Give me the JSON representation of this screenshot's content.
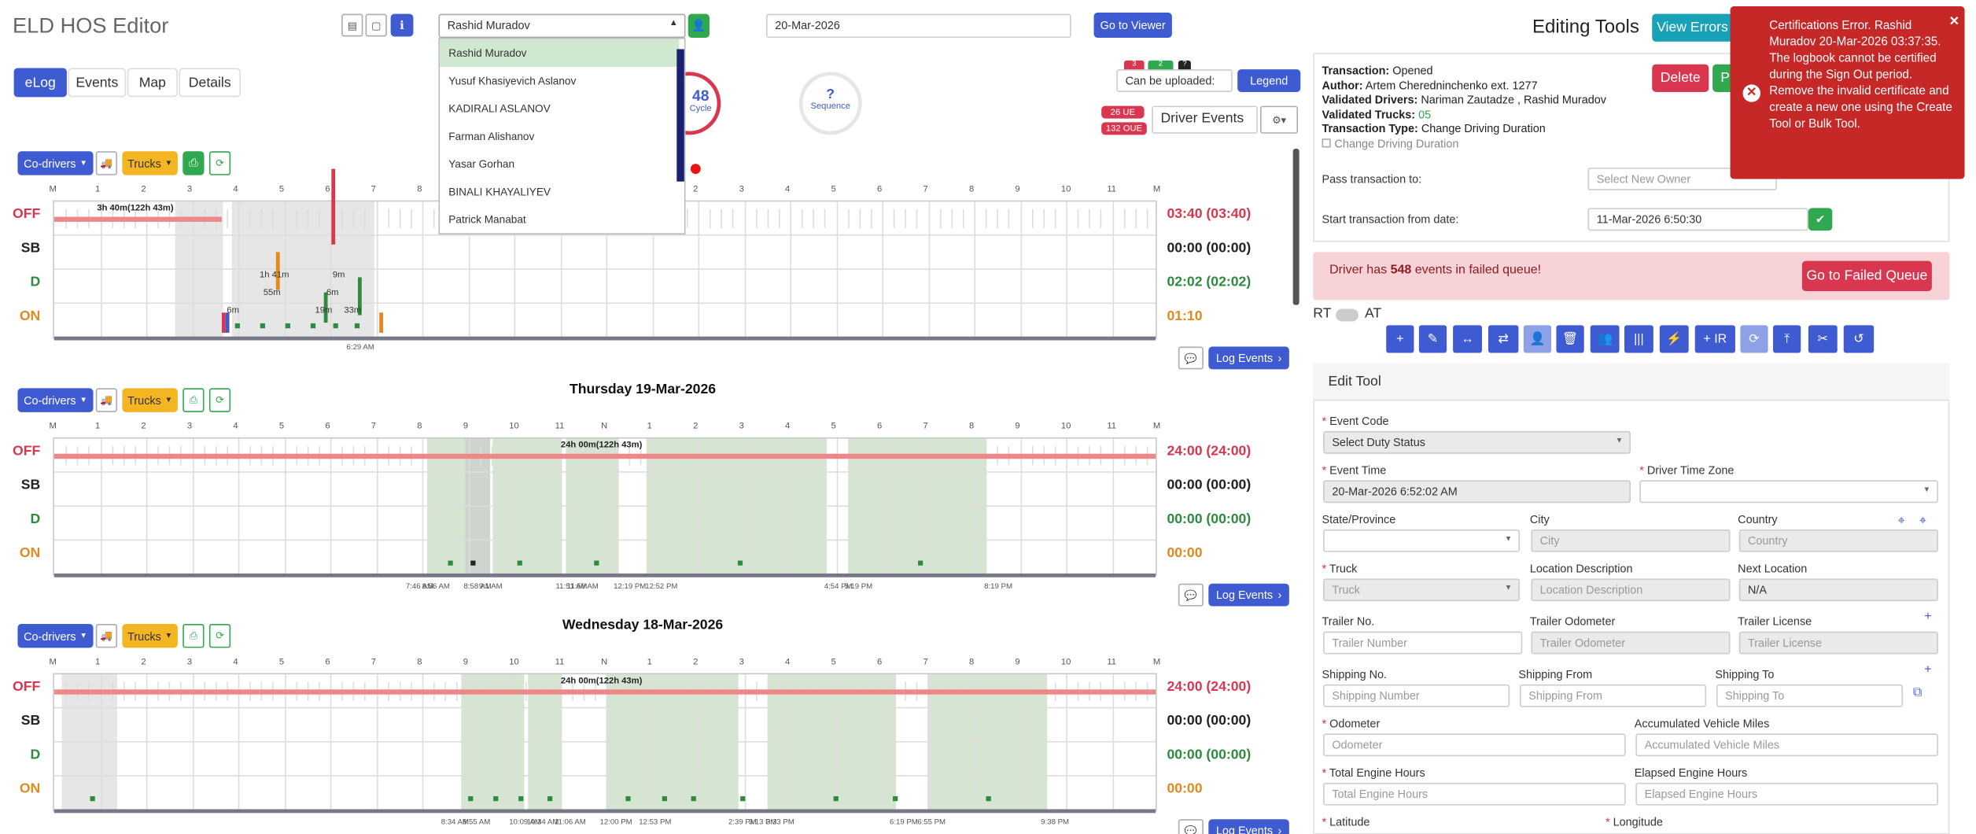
{
  "app": {
    "title": "ELD HOS Editor"
  },
  "header": {
    "driver_select": "Rashid Muradov",
    "date_value": "20-Mar-2026",
    "go_viewer": "Go to Viewer",
    "editing_tools": "Editing Tools",
    "view_errors": "View Errors"
  },
  "driver_dropdown": [
    "Rashid Muradov",
    "Yusuf Khasiyevich Aslanov",
    "KADIRALI ASLANOV",
    "Farman Alishanov",
    "Yasar Gorhan",
    "BINALI KHAYALIYEV",
    "Patrick Manabat"
  ],
  "tabs": [
    "eLog",
    "Events",
    "Map",
    "Details"
  ],
  "cycle": {
    "value": "48",
    "label": "Cycle"
  },
  "sequence": {
    "value": "?",
    "label": "Sequence"
  },
  "top_badges": {
    "b1": "3",
    "b2": "2",
    "b3": "?",
    "ue": "26 UE",
    "oue": "132 OUE"
  },
  "upload_select": "Can be uploaded:",
  "legend": "Legend",
  "driver_events": "Driver Events",
  "hours": [
    "M",
    "1",
    "2",
    "3",
    "4",
    "5",
    "6",
    "7",
    "8",
    "9",
    "10",
    "11",
    "N",
    "1",
    "2",
    "3",
    "4",
    "5",
    "6",
    "7",
    "8",
    "9",
    "10",
    "11",
    "M"
  ],
  "status_labels": [
    "OFF",
    "SB",
    "D",
    "ON"
  ],
  "days": [
    {
      "title": "",
      "codrivers": "Co-drivers",
      "trucks": "Trucks",
      "offlabel": "3h 40m(122h 43m)",
      "totals": [
        "03:40 (03:40)",
        "00:00 (00:00)",
        "02:02 (02:02)",
        "01:10"
      ],
      "log_events": "Log Events",
      "notes": [
        "1h 41m",
        "55m",
        "9m",
        "6m",
        "19m",
        "33m",
        "6m",
        "6:29 AM"
      ]
    },
    {
      "title": "Thursday 19-Mar-2026",
      "codrivers": "Co-drivers",
      "trucks": "Trucks",
      "offlabel": "24h 00m(122h 43m)",
      "totals": [
        "24:00 (24:00)",
        "00:00 (00:00)",
        "00:00 (00:00)",
        "00:00"
      ],
      "log_events": "Log Events",
      "times": [
        "7:46 AM",
        "8:56 AM",
        "8:58 AM",
        "9:1 AM",
        "11:51 AM",
        "11:59 AM",
        "12:19 PM",
        "12:52 PM",
        "4:54 PM",
        "5:19 PM",
        "8:19 PM"
      ]
    },
    {
      "title": "Wednesday 18-Mar-2026",
      "codrivers": "Co-drivers",
      "trucks": "Trucks",
      "offlabel": "24h 00m(122h 43m)",
      "totals": [
        "24:00 (24:00)",
        "00:00 (00:00)",
        "00:00 (00:00)",
        "00:00"
      ],
      "log_events": "Log Events",
      "times": [
        "8:34 AM",
        "8:55 AM",
        "10:09 AM",
        "10:34 AM",
        "11:06 AM",
        "12:00 PM",
        "12:53 PM",
        "2:39 PM",
        "3:13 PM",
        "3:33 PM",
        "6:19 PM",
        "6:55 PM",
        "9:38 PM"
      ]
    }
  ],
  "transaction": {
    "status_label": "Transaction:",
    "status": "Opened",
    "author_label": "Author:",
    "author": "Artem Cheredninchenko ext. 1277",
    "vdrivers_label": "Validated Drivers:",
    "vdrivers": "Nariman Zautadze , Rashid Muradov",
    "vtrucks_label": "Validated Trucks:",
    "vtrucks": "05",
    "type_label": "Transaction Type:",
    "type": "Change Driving Duration",
    "checkbox": "Change Driving Duration",
    "delete": "Delete",
    "publish": "P"
  },
  "pass": {
    "label": "Pass transaction to:",
    "placeholder": "Select New Owner"
  },
  "start": {
    "label": "Start transaction from date:",
    "value": "11-Mar-2026 6:50:30"
  },
  "failed": {
    "pre": "Driver has",
    "count": "548",
    "post": "events in failed queue!",
    "button": "Go to Failed Queue"
  },
  "toggle": {
    "rt": "RT",
    "at": "AT"
  },
  "toolbar": [
    "+",
    "✎",
    "↔",
    "⇄",
    "👤",
    "🗑",
    "👥",
    "|||",
    "⚡",
    "+ IR",
    "⟳",
    "⤒",
    "✂",
    "↺"
  ],
  "edit_tool": {
    "title": "Edit Tool",
    "event_code": {
      "label": "Event Code",
      "value": "Select Duty Status"
    },
    "event_time": {
      "label": "Event Time",
      "value": "20-Mar-2026 6:52:02 AM"
    },
    "tz": {
      "label": "Driver Time Zone",
      "value": ""
    },
    "state": {
      "label": "State/Province",
      "value": ""
    },
    "city": {
      "label": "City",
      "placeholder": "City"
    },
    "country": {
      "label": "Country",
      "placeholder": "Country"
    },
    "truck": {
      "label": "Truck",
      "placeholder": "Truck"
    },
    "locdesc": {
      "label": "Location Description",
      "placeholder": "Location Description"
    },
    "nextloc": {
      "label": "Next Location",
      "value": "N/A"
    },
    "trailer": {
      "label": "Trailer No.",
      "placeholder": "Trailer Number"
    },
    "trailer_odo": {
      "label": "Trailer Odometer",
      "placeholder": "Trailer Odometer"
    },
    "trailer_lic": {
      "label": "Trailer License",
      "placeholder": "Trailer License"
    },
    "ship_no": {
      "label": "Shipping No.",
      "placeholder": "Shipping Number"
    },
    "ship_from": {
      "label": "Shipping From",
      "placeholder": "Shipping From"
    },
    "ship_to": {
      "label": "Shipping To",
      "placeholder": "Shipping To"
    },
    "odometer": {
      "label": "Odometer",
      "placeholder": "Odometer"
    },
    "acc_miles": {
      "label": "Accumulated Vehicle Miles",
      "placeholder": "Accumulated Vehicle Miles"
    },
    "eng_hours": {
      "label": "Total Engine Hours",
      "placeholder": "Total Engine Hours"
    },
    "elapsed": {
      "label": "Elapsed Engine Hours",
      "placeholder": "Elapsed Engine Hours"
    },
    "lat": {
      "label": "Latitude"
    },
    "lon": {
      "label": "Longitude"
    }
  },
  "toast": {
    "message": "Certifications Error. Rashid Muradov 20-Mar-2026 03:37:35. The logbook cannot be certified during the Sign Out period. Remove the invalid certificate and create a new one using the Create Tool or Bulk Tool."
  },
  "colors": {
    "off": "#d9364f",
    "sb": "#222222",
    "d": "#2e8b3e",
    "on": "#e08a1e",
    "accent": "#3f5bd1",
    "toast": "#c62828"
  }
}
